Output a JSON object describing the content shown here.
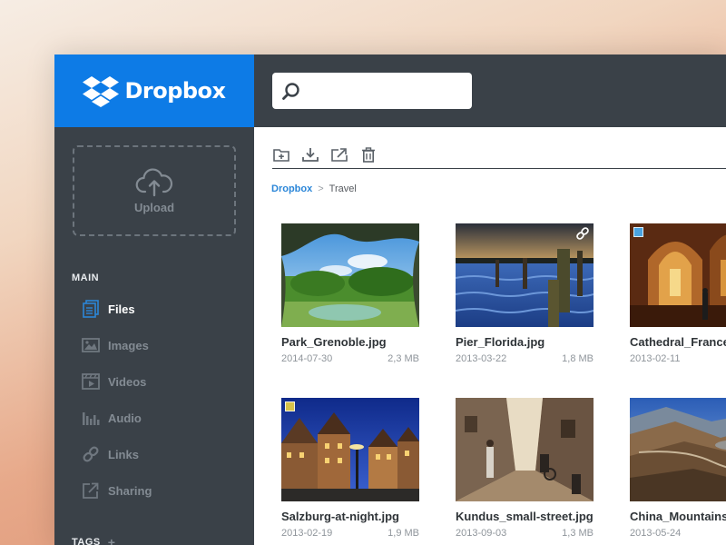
{
  "brand": {
    "name": "Dropbox",
    "color": "#0d7be6"
  },
  "search": {
    "value": "",
    "placeholder": ""
  },
  "sidebar": {
    "upload_label": "Upload",
    "section_main": "MAIN",
    "items": [
      {
        "label": "Files",
        "icon": "files-icon",
        "active": true
      },
      {
        "label": "Images",
        "icon": "images-icon",
        "active": false
      },
      {
        "label": "Videos",
        "icon": "videos-icon",
        "active": false
      },
      {
        "label": "Audio",
        "icon": "audio-icon",
        "active": false
      },
      {
        "label": "Links",
        "icon": "links-icon",
        "active": false
      },
      {
        "label": "Sharing",
        "icon": "sharing-icon",
        "active": false
      }
    ],
    "section_tags": "TAGS",
    "tags_add": "+"
  },
  "toolbar": {
    "actions": [
      "new-folder-icon",
      "download-icon",
      "move-icon",
      "trash-icon"
    ]
  },
  "breadcrumb": {
    "root": "Dropbox",
    "separator": ">",
    "current": "Travel"
  },
  "files": [
    {
      "name": "Park_Grenoble.jpg",
      "date": "2014-07-30",
      "size": "2,3 MB"
    },
    {
      "name": "Pier_Florida.jpg",
      "date": "2013-03-22",
      "size": "1,8 MB",
      "shared_link": true
    },
    {
      "name": "Cathedral_France",
      "date": "2013-02-11",
      "size": "",
      "tag_color": "#4aa3e0"
    },
    {
      "name": "Salzburg-at-night.jpg",
      "date": "2013-02-19",
      "size": "1,9 MB",
      "tag_color": "#d6c24a"
    },
    {
      "name": "Kundus_small-street.jpg",
      "date": "2013-09-03",
      "size": "1,3 MB"
    },
    {
      "name": "China_Mountains",
      "date": "2013-05-24",
      "size": ""
    }
  ]
}
